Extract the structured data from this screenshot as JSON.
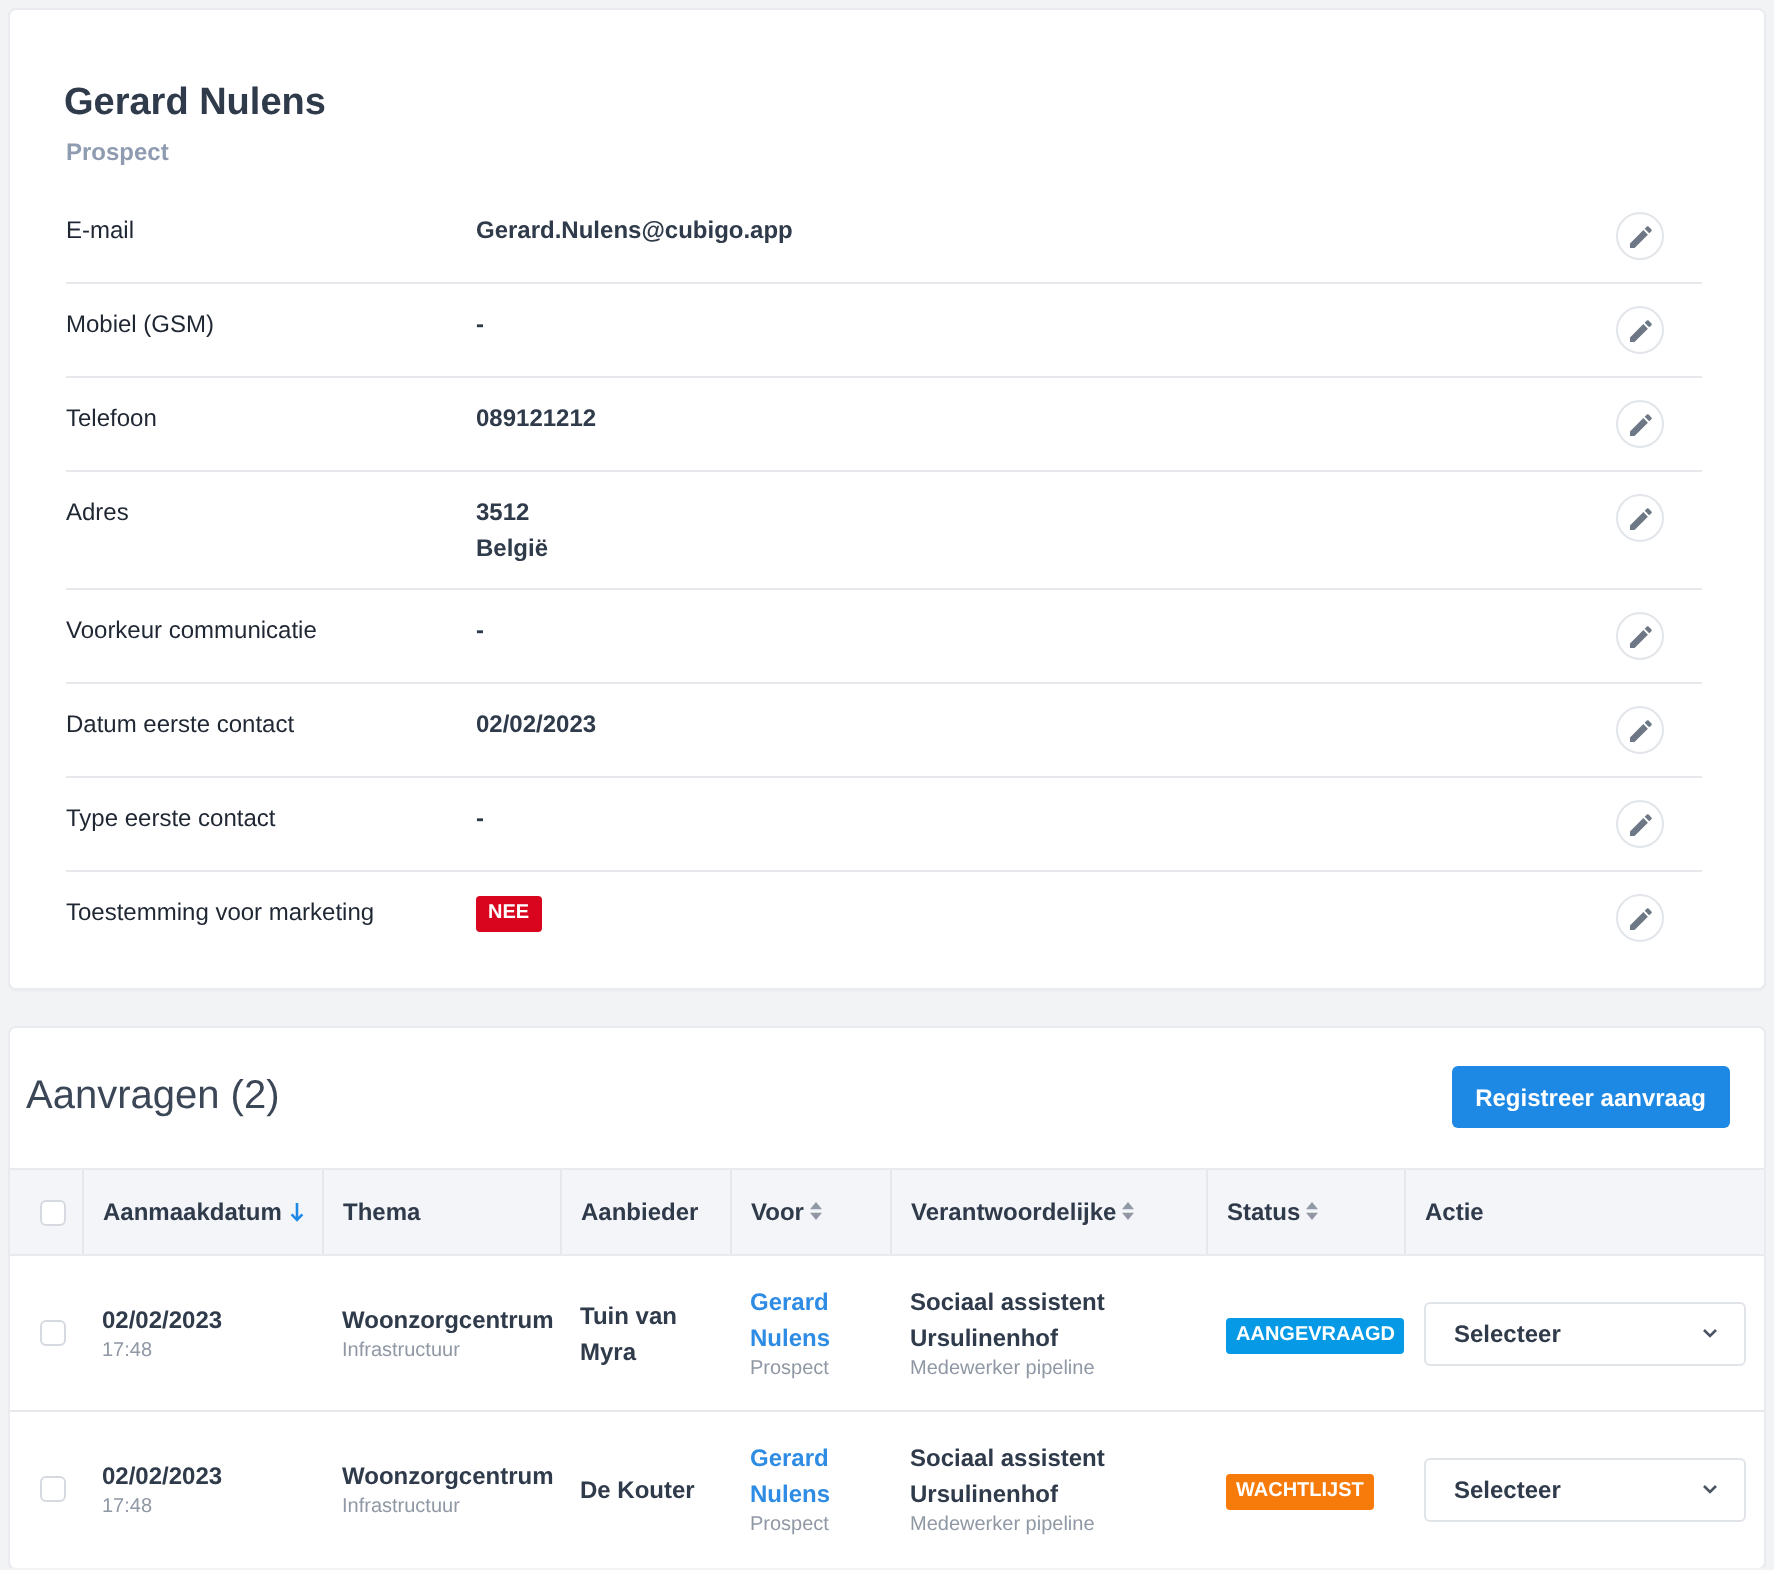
{
  "contact": {
    "name": "Gerard Nulens",
    "type": "Prospect"
  },
  "fields": [
    {
      "label": "E-mail",
      "kind": "text",
      "value": "Gerard.Nulens@cubigo.app"
    },
    {
      "label": "Mobiel (GSM)",
      "kind": "text",
      "value": "-"
    },
    {
      "label": "Telefoon",
      "kind": "text",
      "value": "089121212"
    },
    {
      "label": "Adres",
      "kind": "lines",
      "lines": [
        "3512",
        "België"
      ]
    },
    {
      "label": "Voorkeur communicatie",
      "kind": "text",
      "value": "-"
    },
    {
      "label": "Datum eerste contact",
      "kind": "text",
      "value": "02/02/2023"
    },
    {
      "label": "Type eerste contact",
      "kind": "text",
      "value": "-"
    },
    {
      "label": "Toestemming voor marketing",
      "kind": "badge",
      "value": "NEE"
    }
  ],
  "requests": {
    "title": "Aanvragen (2)",
    "button": "Registreer aanvraag",
    "select_all": {
      "checked": false
    },
    "columns": [
      {
        "label": "Aanmaakdatum",
        "sorted": true
      },
      {
        "label": "Thema"
      },
      {
        "label": "Aanbieder"
      },
      {
        "label": "Voor",
        "sorted": false
      },
      {
        "label": "Verantwoordelijke",
        "sorted": false
      },
      {
        "label": "Status",
        "sorted": false
      },
      {
        "label": "Actie"
      }
    ],
    "rows": [
      {
        "checked": false,
        "date": "02/02/2023",
        "time": "17:48",
        "theme": "Woonzorgcentrum",
        "theme_category": "Infrastructuur",
        "provider": "Tuin van Myra",
        "for": {
          "name": "Gerard Nulens",
          "type": "Prospect"
        },
        "responsible": {
          "name": "Sociaal assistent Ursulinenhof",
          "role": "Medewerker pipeline"
        },
        "status": {
          "label": "AANGEVRAAGD",
          "color": "#069ae6"
        },
        "action": "Selecteer"
      },
      {
        "checked": false,
        "date": "02/02/2023",
        "time": "17:48",
        "theme": "Woonzorgcentrum",
        "theme_category": "Infrastructuur",
        "provider": "De Kouter",
        "for": {
          "name": "Gerard Nulens",
          "type": "Prospect"
        },
        "responsible": {
          "name": "Sociaal assistent Ursulinenhof",
          "role": "Medewerker pipeline"
        },
        "status": {
          "label": "WACHTLIJST",
          "color": "#f77b0a"
        },
        "action": "Selecteer"
      }
    ]
  }
}
